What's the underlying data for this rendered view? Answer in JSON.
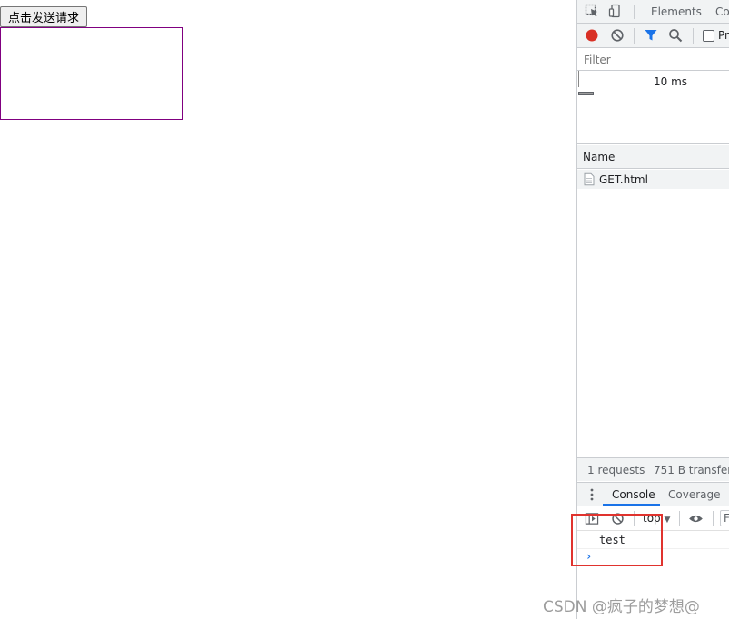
{
  "page": {
    "send_button_label": "点击发送请求"
  },
  "devtools": {
    "main_tabs": [
      "Elements",
      "Co"
    ],
    "preserve_log_label": "Pr",
    "filter_placeholder": "Filter",
    "overview_tick": "10 ms",
    "table": {
      "column_name": "Name",
      "rows": [
        {
          "name": "GET.html"
        }
      ]
    },
    "summary": {
      "requests": "1 requests",
      "transferred": "751 B transferre"
    },
    "drawer_tabs": [
      "Console",
      "Coverage"
    ],
    "console": {
      "context": "top",
      "filter_placeholder": "F",
      "messages": [
        "test"
      ],
      "prompt": "›"
    }
  },
  "watermark": "CSDN @疯子的梦想@",
  "colors": {
    "record": "#d93025",
    "accent": "#1a73e8",
    "highlight": "#e0332e",
    "box_border": "#800080"
  }
}
